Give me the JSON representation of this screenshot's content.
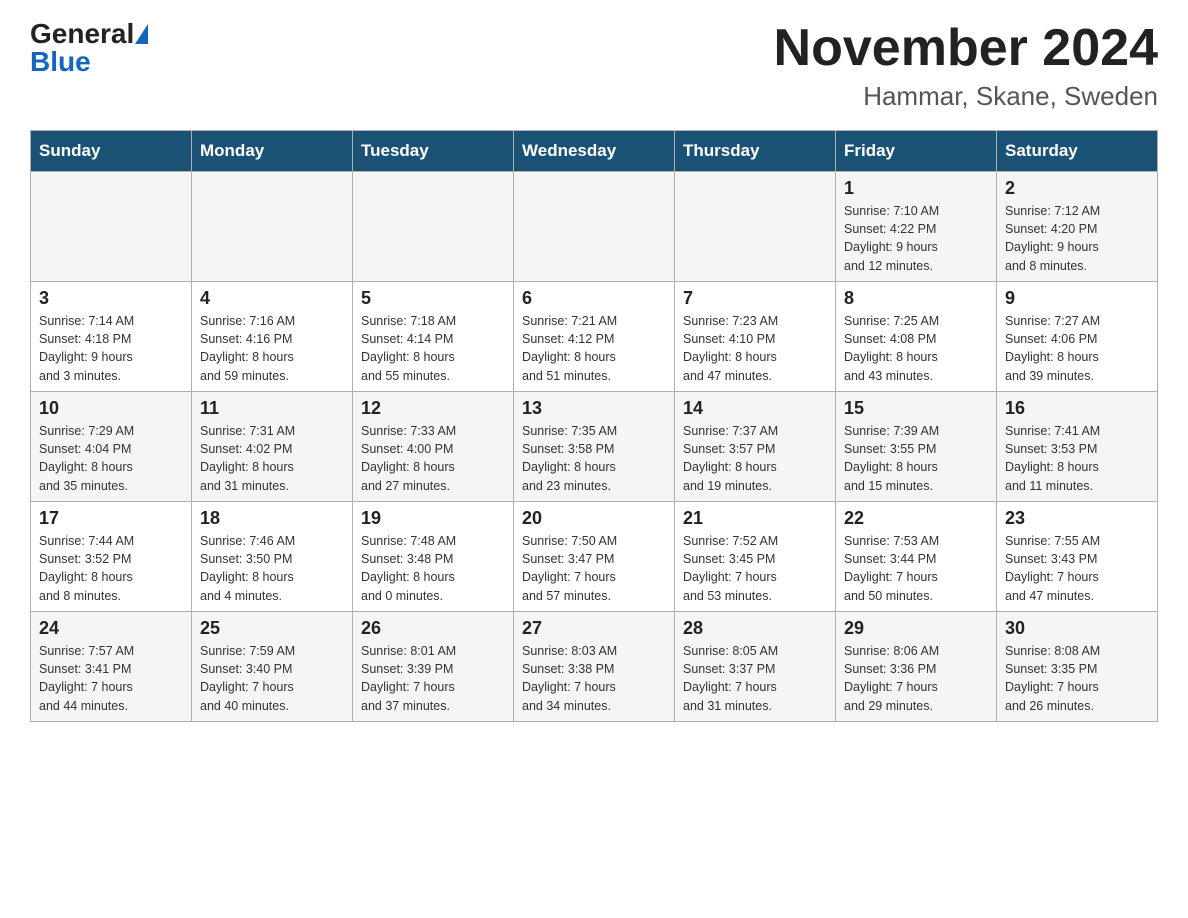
{
  "header": {
    "logo_general": "General",
    "logo_blue": "Blue",
    "month_title": "November 2024",
    "location": "Hammar, Skane, Sweden"
  },
  "days_of_week": [
    "Sunday",
    "Monday",
    "Tuesday",
    "Wednesday",
    "Thursday",
    "Friday",
    "Saturday"
  ],
  "weeks": [
    [
      {
        "day": "",
        "info": ""
      },
      {
        "day": "",
        "info": ""
      },
      {
        "day": "",
        "info": ""
      },
      {
        "day": "",
        "info": ""
      },
      {
        "day": "",
        "info": ""
      },
      {
        "day": "1",
        "info": "Sunrise: 7:10 AM\nSunset: 4:22 PM\nDaylight: 9 hours\nand 12 minutes."
      },
      {
        "day": "2",
        "info": "Sunrise: 7:12 AM\nSunset: 4:20 PM\nDaylight: 9 hours\nand 8 minutes."
      }
    ],
    [
      {
        "day": "3",
        "info": "Sunrise: 7:14 AM\nSunset: 4:18 PM\nDaylight: 9 hours\nand 3 minutes."
      },
      {
        "day": "4",
        "info": "Sunrise: 7:16 AM\nSunset: 4:16 PM\nDaylight: 8 hours\nand 59 minutes."
      },
      {
        "day": "5",
        "info": "Sunrise: 7:18 AM\nSunset: 4:14 PM\nDaylight: 8 hours\nand 55 minutes."
      },
      {
        "day": "6",
        "info": "Sunrise: 7:21 AM\nSunset: 4:12 PM\nDaylight: 8 hours\nand 51 minutes."
      },
      {
        "day": "7",
        "info": "Sunrise: 7:23 AM\nSunset: 4:10 PM\nDaylight: 8 hours\nand 47 minutes."
      },
      {
        "day": "8",
        "info": "Sunrise: 7:25 AM\nSunset: 4:08 PM\nDaylight: 8 hours\nand 43 minutes."
      },
      {
        "day": "9",
        "info": "Sunrise: 7:27 AM\nSunset: 4:06 PM\nDaylight: 8 hours\nand 39 minutes."
      }
    ],
    [
      {
        "day": "10",
        "info": "Sunrise: 7:29 AM\nSunset: 4:04 PM\nDaylight: 8 hours\nand 35 minutes."
      },
      {
        "day": "11",
        "info": "Sunrise: 7:31 AM\nSunset: 4:02 PM\nDaylight: 8 hours\nand 31 minutes."
      },
      {
        "day": "12",
        "info": "Sunrise: 7:33 AM\nSunset: 4:00 PM\nDaylight: 8 hours\nand 27 minutes."
      },
      {
        "day": "13",
        "info": "Sunrise: 7:35 AM\nSunset: 3:58 PM\nDaylight: 8 hours\nand 23 minutes."
      },
      {
        "day": "14",
        "info": "Sunrise: 7:37 AM\nSunset: 3:57 PM\nDaylight: 8 hours\nand 19 minutes."
      },
      {
        "day": "15",
        "info": "Sunrise: 7:39 AM\nSunset: 3:55 PM\nDaylight: 8 hours\nand 15 minutes."
      },
      {
        "day": "16",
        "info": "Sunrise: 7:41 AM\nSunset: 3:53 PM\nDaylight: 8 hours\nand 11 minutes."
      }
    ],
    [
      {
        "day": "17",
        "info": "Sunrise: 7:44 AM\nSunset: 3:52 PM\nDaylight: 8 hours\nand 8 minutes."
      },
      {
        "day": "18",
        "info": "Sunrise: 7:46 AM\nSunset: 3:50 PM\nDaylight: 8 hours\nand 4 minutes."
      },
      {
        "day": "19",
        "info": "Sunrise: 7:48 AM\nSunset: 3:48 PM\nDaylight: 8 hours\nand 0 minutes."
      },
      {
        "day": "20",
        "info": "Sunrise: 7:50 AM\nSunset: 3:47 PM\nDaylight: 7 hours\nand 57 minutes."
      },
      {
        "day": "21",
        "info": "Sunrise: 7:52 AM\nSunset: 3:45 PM\nDaylight: 7 hours\nand 53 minutes."
      },
      {
        "day": "22",
        "info": "Sunrise: 7:53 AM\nSunset: 3:44 PM\nDaylight: 7 hours\nand 50 minutes."
      },
      {
        "day": "23",
        "info": "Sunrise: 7:55 AM\nSunset: 3:43 PM\nDaylight: 7 hours\nand 47 minutes."
      }
    ],
    [
      {
        "day": "24",
        "info": "Sunrise: 7:57 AM\nSunset: 3:41 PM\nDaylight: 7 hours\nand 44 minutes."
      },
      {
        "day": "25",
        "info": "Sunrise: 7:59 AM\nSunset: 3:40 PM\nDaylight: 7 hours\nand 40 minutes."
      },
      {
        "day": "26",
        "info": "Sunrise: 8:01 AM\nSunset: 3:39 PM\nDaylight: 7 hours\nand 37 minutes."
      },
      {
        "day": "27",
        "info": "Sunrise: 8:03 AM\nSunset: 3:38 PM\nDaylight: 7 hours\nand 34 minutes."
      },
      {
        "day": "28",
        "info": "Sunrise: 8:05 AM\nSunset: 3:37 PM\nDaylight: 7 hours\nand 31 minutes."
      },
      {
        "day": "29",
        "info": "Sunrise: 8:06 AM\nSunset: 3:36 PM\nDaylight: 7 hours\nand 29 minutes."
      },
      {
        "day": "30",
        "info": "Sunrise: 8:08 AM\nSunset: 3:35 PM\nDaylight: 7 hours\nand 26 minutes."
      }
    ]
  ]
}
